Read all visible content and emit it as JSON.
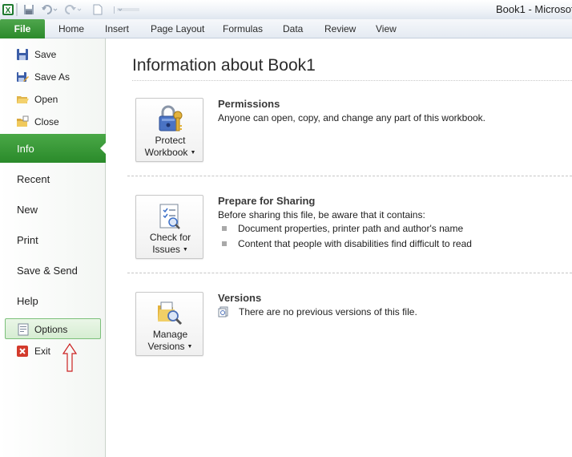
{
  "window": {
    "title": "Book1  -  Microsof"
  },
  "ribbon": {
    "tabs": [
      "File",
      "Home",
      "Insert",
      "Page Layout",
      "Formulas",
      "Data",
      "Review",
      "View"
    ]
  },
  "nav": {
    "commands": [
      {
        "label": "Save",
        "icon": "save-icon"
      },
      {
        "label": "Save As",
        "icon": "save-as-icon"
      },
      {
        "label": "Open",
        "icon": "open-folder-icon"
      },
      {
        "label": "Close",
        "icon": "close-folder-icon"
      }
    ],
    "views": [
      "Info",
      "Recent",
      "New",
      "Print",
      "Save & Send",
      "Help"
    ],
    "options": "Options",
    "exit": "Exit"
  },
  "main": {
    "title": "Information about Book1",
    "permissions": {
      "button_line1": "Protect",
      "button_line2": "Workbook",
      "heading": "Permissions",
      "description": "Anyone can open, copy, and change any part of this workbook."
    },
    "sharing": {
      "button_line1": "Check for",
      "button_line2": "Issues",
      "heading": "Prepare for Sharing",
      "description": "Before sharing this file, be aware that it contains:",
      "items": [
        "Document properties, printer path and author's name",
        "Content that people with disabilities find difficult to read"
      ]
    },
    "versions": {
      "button_line1": "Manage",
      "button_line2": "Versions",
      "heading": "Versions",
      "description": "There are no previous versions of this file."
    }
  },
  "colors": {
    "accent": "#2f8f2f",
    "annotation": "#cc2222"
  }
}
